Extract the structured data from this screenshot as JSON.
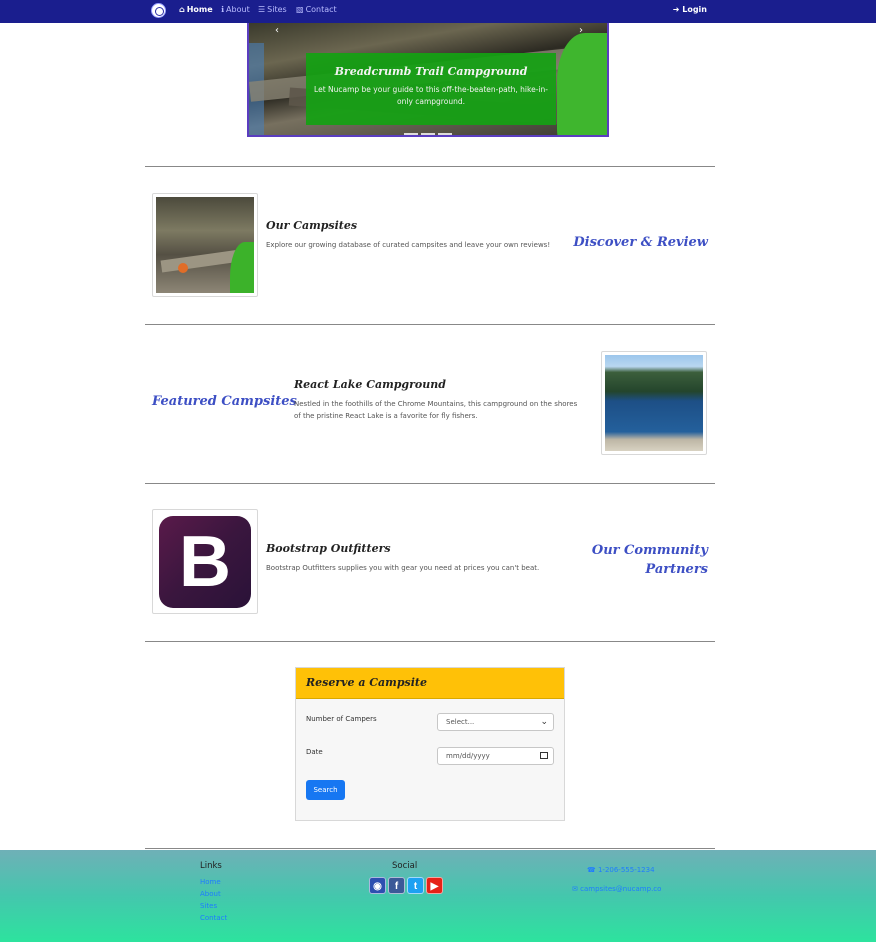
{
  "nav": {
    "links": [
      {
        "label": "Home",
        "icon": "home-icon"
      },
      {
        "label": "About",
        "icon": "info-icon"
      },
      {
        "label": "Sites",
        "icon": "list-icon"
      },
      {
        "label": "Contact",
        "icon": "address-card-icon"
      }
    ],
    "login": "Login",
    "colors": {
      "bar": "#1a1e8e",
      "active": "#ffffff",
      "inactive": "#b9bcff"
    }
  },
  "carousel": {
    "title": "Breadcrumb Trail Campground",
    "text": "Let Nucamp be your guide to this off-the-beaten-path, hike-in-only campground.",
    "caption_color": "#14a213"
  },
  "sections": [
    {
      "heading": "Discover & Review",
      "title": "Our Campsites",
      "text": "Explore our growing database of curated campsites and leave your own reviews!"
    },
    {
      "heading": "Featured Campsites",
      "title": "React Lake Campground",
      "text": "Nestled in the foothills of the Chrome Mountains, this campground on the shores of the pristine React Lake is a favorite for fly fishers."
    },
    {
      "heading_line1": "Our Community",
      "heading_line2": "Partners",
      "title": "Bootstrap Outfitters",
      "text": "Bootstrap Outfitters supplies you with gear you need at prices you can't beat.",
      "logo_letter": "B"
    }
  ],
  "reserve": {
    "header": "Reserve a Campsite",
    "campers_label": "Number of Campers",
    "campers_value": "Select...",
    "date_label": "Date",
    "date_placeholder": "mm/dd/yyyy",
    "search_label": "Search",
    "header_color": "#ffc107",
    "button_color": "#1777f2"
  },
  "footer": {
    "links_heading": "Links",
    "links": [
      "Home",
      "About",
      "Sites",
      "Contact"
    ],
    "social_heading": "Social",
    "social": [
      {
        "name": "instagram-icon",
        "color": "#2d4fb0"
      },
      {
        "name": "facebook-icon",
        "color": "#3b5998"
      },
      {
        "name": "twitter-icon",
        "color": "#1da1f2"
      },
      {
        "name": "youtube-icon",
        "color": "#e62117"
      }
    ],
    "phone": "1-206-555-1234",
    "email": "campsites@nucamp.co"
  }
}
